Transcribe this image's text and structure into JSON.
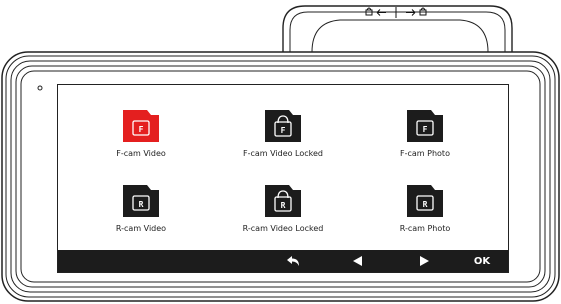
{
  "menu": {
    "items": [
      {
        "label": "F-cam Video",
        "tile_letter": "F",
        "selected": true,
        "locked": false,
        "color": "#e41f1f"
      },
      {
        "label": "F-cam Video Locked",
        "tile_letter": "F",
        "selected": false,
        "locked": true,
        "color": "#1c1c1c"
      },
      {
        "label": "F-cam Photo",
        "tile_letter": "F",
        "selected": false,
        "locked": false,
        "color": "#1c1c1c"
      },
      {
        "label": "R-cam Video",
        "tile_letter": "R",
        "selected": false,
        "locked": false,
        "color": "#1c1c1c"
      },
      {
        "label": "R-cam Video Locked",
        "tile_letter": "R",
        "selected": false,
        "locked": true,
        "color": "#1c1c1c"
      },
      {
        "label": "R-cam Photo",
        "tile_letter": "R",
        "selected": false,
        "locked": false,
        "color": "#1c1c1c"
      }
    ]
  },
  "toolbar": {
    "back_icon": "return-arrow-icon",
    "prev_icon": "triangle-left-icon",
    "next_icon": "triangle-right-icon",
    "ok_label": "OK"
  },
  "colors": {
    "accent": "#e41f1f",
    "folder": "#1c1c1c",
    "toolbar": "#1c1c1c"
  }
}
